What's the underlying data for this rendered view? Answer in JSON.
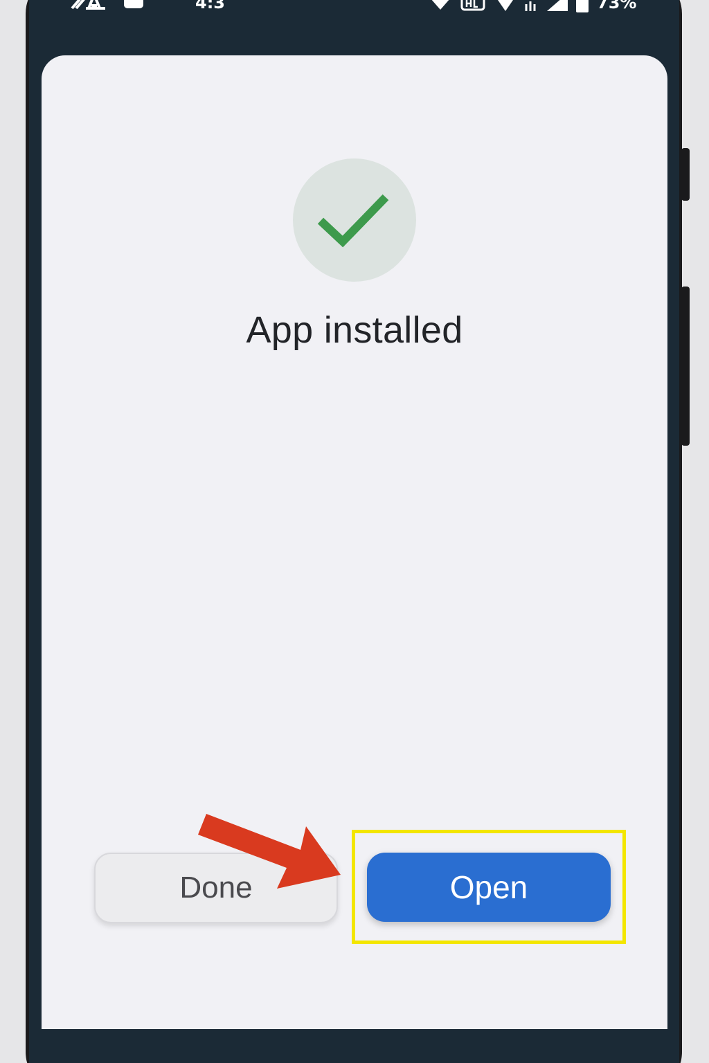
{
  "status_bar": {
    "time": "4:3",
    "battery": "73%",
    "icons": [
      "signal-activity-icon",
      "notification-icon",
      "wifi-icon",
      "hd-call-icon",
      "location-icon",
      "data-icon",
      "cell-signal-icon",
      "battery-icon"
    ]
  },
  "dialog": {
    "icon": "check-icon",
    "title": "App installed"
  },
  "actions": {
    "done_label": "Done",
    "open_label": "Open"
  },
  "annotation": {
    "highlight_color": "#f3e600",
    "arrow_color": "#d93a1f",
    "target": "Open"
  },
  "colors": {
    "primary": "#2a6ed1",
    "success": "#3d9a4c"
  }
}
